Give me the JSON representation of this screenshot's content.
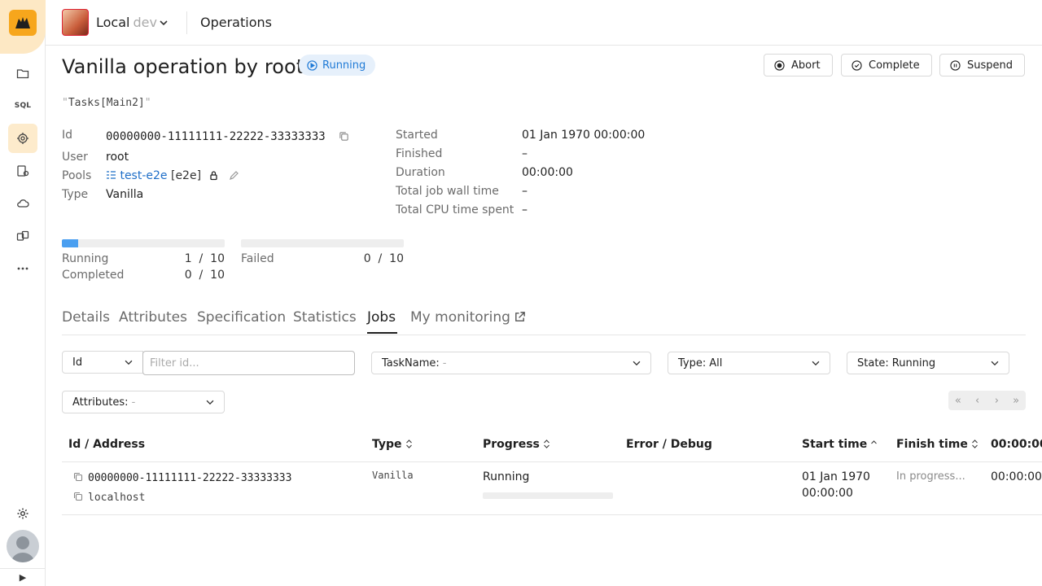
{
  "header": {
    "cluster_name": "Local",
    "cluster_env": "dev",
    "breadcrumb": "Operations"
  },
  "sidebar": {
    "items": [
      {
        "icon": "folder-icon"
      },
      {
        "icon": "sql-icon",
        "label": "SQL"
      },
      {
        "icon": "operations-icon",
        "active": true
      },
      {
        "icon": "accounts-icon"
      },
      {
        "icon": "cloud-icon"
      },
      {
        "icon": "components-icon"
      },
      {
        "icon": "more-icon"
      }
    ]
  },
  "operation": {
    "title": "Vanilla operation by root",
    "status": "Running",
    "task_expression": "Tasks[Main2]",
    "actions": {
      "abort": "Abort",
      "complete": "Complete",
      "suspend": "Suspend"
    },
    "meta_left": {
      "id_label": "Id",
      "id_value": "00000000-11111111-22222-33333333",
      "user_label": "User",
      "user_value": "root",
      "pools_label": "Pools",
      "pool_name": "test-e2e",
      "pool_tree": "[e2e]",
      "type_label": "Type",
      "type_value": "Vanilla"
    },
    "meta_right": [
      {
        "label": "Started",
        "value": "01 Jan 1970 00:00:00"
      },
      {
        "label": "Finished",
        "value": "–"
      },
      {
        "label": "Duration",
        "value": "00:00:00"
      },
      {
        "label": "Total job wall time",
        "value": "–"
      },
      {
        "label": "Total CPU time spent",
        "value": "–"
      }
    ],
    "progress": {
      "running_label": "Running",
      "running_value": "1  /  10",
      "running_fraction": 0.1,
      "completed_label": "Completed",
      "completed_value": "0  /  10",
      "failed_label": "Failed",
      "failed_value": "0  /  10",
      "failed_fraction": 0
    }
  },
  "tabs": [
    "Details",
    "Attributes",
    "Specification",
    "Statistics",
    "Jobs",
    "My monitoring"
  ],
  "active_tab": "Jobs",
  "filters": {
    "id_select": "Id",
    "id_placeholder": "Filter id...",
    "taskname_label": "TaskName:",
    "taskname_value": "-",
    "type_label": "Type:",
    "type_value": "All",
    "state_label": "State:",
    "state_value": "Running",
    "attributes_label": "Attributes:",
    "attributes_value": "-"
  },
  "pager": [
    "«",
    "‹",
    "›",
    "»"
  ],
  "table": {
    "columns": [
      "Id / Address",
      "Type",
      "Progress",
      "Error / Debug",
      "Start time",
      "Finish time",
      "00:00:00"
    ],
    "rows": [
      {
        "id": "00000000-11111111-22222-33333333",
        "address": "localhost",
        "type": "Vanilla",
        "progress": "Running",
        "progress_fraction": 0,
        "error": "",
        "start_date": "01 Jan 1970",
        "start_time": "00:00:00",
        "finish": "In progress...",
        "duration": "00:00:00"
      }
    ]
  },
  "colors": {
    "accent": "#1f7ad6",
    "progress_fill": "#4a9ff0",
    "brand": "#f7a61c",
    "status_bg": "#e6f0fb"
  }
}
